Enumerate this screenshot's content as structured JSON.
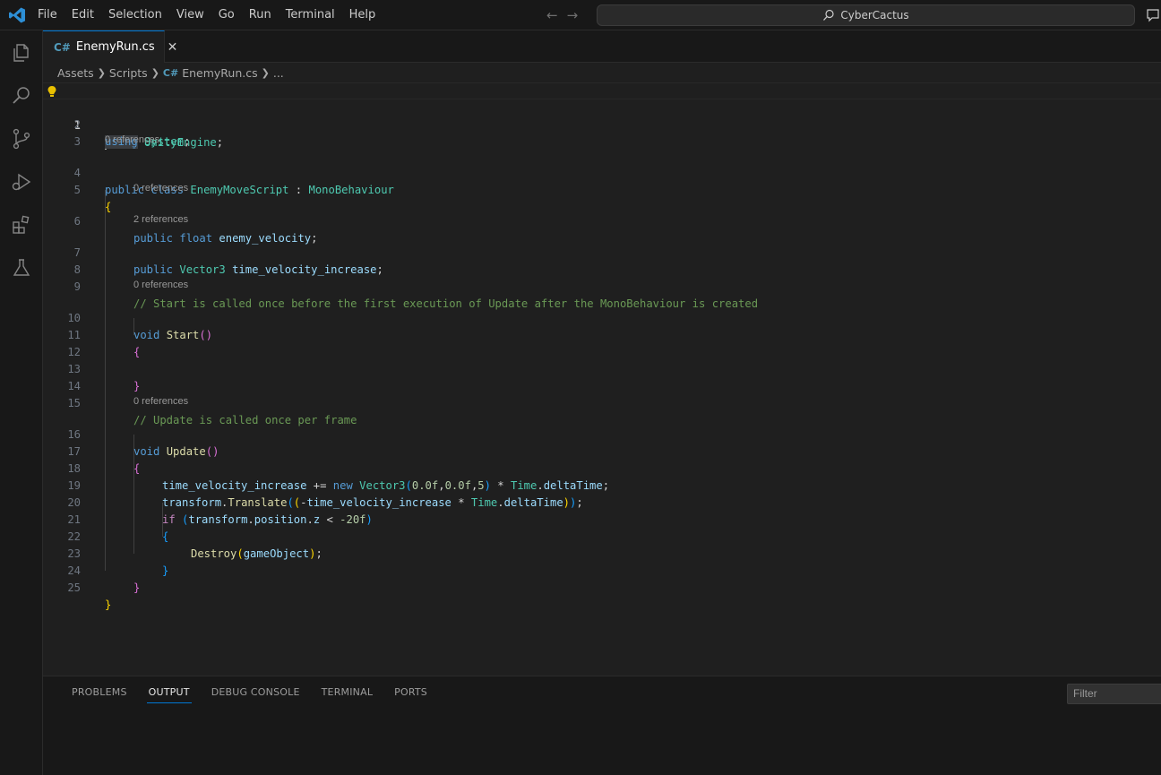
{
  "menu": [
    "File",
    "Edit",
    "Selection",
    "View",
    "Go",
    "Run",
    "Terminal",
    "Help"
  ],
  "command_center": "CyberCactus",
  "tab": {
    "title": "EnemyRun.cs",
    "icon": "C#"
  },
  "breadcrumb": [
    "Assets",
    "Scripts",
    "EnemyRun.cs",
    "..."
  ],
  "code_lens": {
    "class_refs": "0 references",
    "enemy_velocity_refs": "0 references",
    "time_velocity_refs": "2 references",
    "start_refs": "0 references",
    "update_refs": "0 references"
  },
  "line_numbers": [
    "1",
    "2",
    "3",
    "4",
    "5",
    "6",
    "7",
    "8",
    "9",
    "10",
    "11",
    "12",
    "13",
    "14",
    "15",
    "16",
    "17",
    "18",
    "19",
    "20",
    "21",
    "22",
    "23",
    "24",
    "25"
  ],
  "code": {
    "l1_kw": "using",
    "l1_ns": "UnityEngine",
    "l1_end": ";",
    "l2_kw": "using",
    "l2_ns": "System",
    "l2_end": ";",
    "l4_public": "public",
    "l4_class": "class",
    "l4_name": "EnemyMoveScript",
    "l4_colon": " : ",
    "l4_base": "MonoBehaviour",
    "l5_brace": "{",
    "l6_public": "public",
    "l6_float": "float",
    "l6_var": "enemy_velocity",
    "l6_end": ";",
    "l7_public": "public",
    "l7_type": "Vector3",
    "l7_var": "time_velocity_increase",
    "l7_end": ";",
    "l9_comment": "// Start is called once before the first execution of Update after the MonoBehaviour is created",
    "l10_void": "void",
    "l10_fn": "Start",
    "l10_parens": "()",
    "l11_brace": "{",
    "l13_brace": "}",
    "l15_comment": "// Update is called once per frame",
    "l16_void": "void",
    "l16_fn": "Update",
    "l16_parens": "()",
    "l17_brace": "{",
    "l18_var": "time_velocity_increase",
    "l18_op": " += ",
    "l18_new": "new",
    "l18_type": "Vector3",
    "l18_open": "(",
    "l18_n1": "0.0f",
    "l18_c1": ",",
    "l18_n2": "0.0f",
    "l18_c2": ",",
    "l18_n3": "5",
    "l18_close": ")",
    "l18_mul": " * ",
    "l18_time": "Time",
    "l18_dot": ".",
    "l18_dt": "deltaTime",
    "l18_end": ";",
    "l19_obj": "transform",
    "l19_dot": ".",
    "l19_fn": "Translate",
    "l19_open1": "(",
    "l19_open2": "(",
    "l19_minus": "-",
    "l19_var": "time_velocity_increase",
    "l19_mul": " * ",
    "l19_time": "Time",
    "l19_dot2": ".",
    "l19_dt": "deltaTime",
    "l19_close2": ")",
    "l19_close1": ")",
    "l19_end": ";",
    "l20_if": "if",
    "l20_open": "(",
    "l20_obj": "transform",
    "l20_dot": ".",
    "l20_pos": "position",
    "l20_dot2": ".",
    "l20_z": "z",
    "l20_lt": " < ",
    "l20_num": "-20f",
    "l20_close": ")",
    "l21_brace": "{",
    "l22_fn": "Destroy",
    "l22_open": "(",
    "l22_arg": "gameObject",
    "l22_close": ")",
    "l22_end": ";",
    "l23_brace": "}",
    "l24_brace": "}",
    "l25_brace": "}"
  },
  "panel_tabs": [
    "PROBLEMS",
    "OUTPUT",
    "DEBUG CONSOLE",
    "TERMINAL",
    "PORTS"
  ],
  "panel_active": "OUTPUT",
  "filter_placeholder": "Filter",
  "colors": {
    "accent": "#0078d4",
    "keyword": "#569cd6",
    "type": "#4ec9b0",
    "function": "#dcdcaa",
    "variable": "#9cdcfe",
    "comment": "#6a9955",
    "number": "#b5cea8"
  }
}
